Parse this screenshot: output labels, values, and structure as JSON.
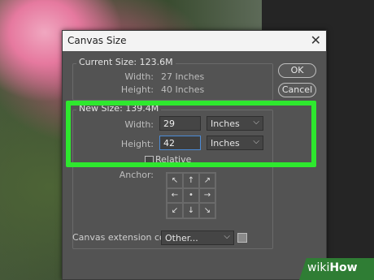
{
  "dialog": {
    "title": "Canvas Size",
    "current": {
      "legend": "Current Size: 123.6M",
      "width_label": "Width:",
      "width_value": "27 Inches",
      "height_label": "Height:",
      "height_value": "40 Inches"
    },
    "new": {
      "legend": "New Size: 139.4M",
      "width_label": "Width:",
      "width_value": "29",
      "width_unit": "Inches",
      "height_label": "Height:",
      "height_value": "42",
      "height_unit": "Inches",
      "relative_label": "Relative",
      "relative_checked": false,
      "anchor_label": "Anchor:"
    },
    "buttons": {
      "ok": "OK",
      "cancel": "Cancel"
    },
    "extension": {
      "label": "Canvas extension color:",
      "value": "Other..."
    }
  },
  "watermark": {
    "part1": "wiki",
    "part2": "How"
  },
  "colors": {
    "highlight": "#2ee82e",
    "dialog_bg": "#535353",
    "titlebar_bg": "#f3f3f3",
    "watermark_bg": "#2f7d34"
  },
  "icons": {
    "close": "close-icon",
    "chevron": "chevron-down-icon",
    "anchor_arrows": [
      "arrow-nw",
      "arrow-n",
      "arrow-ne",
      "arrow-w",
      "anchor-center",
      "arrow-e",
      "arrow-sw",
      "arrow-s",
      "arrow-se"
    ]
  }
}
